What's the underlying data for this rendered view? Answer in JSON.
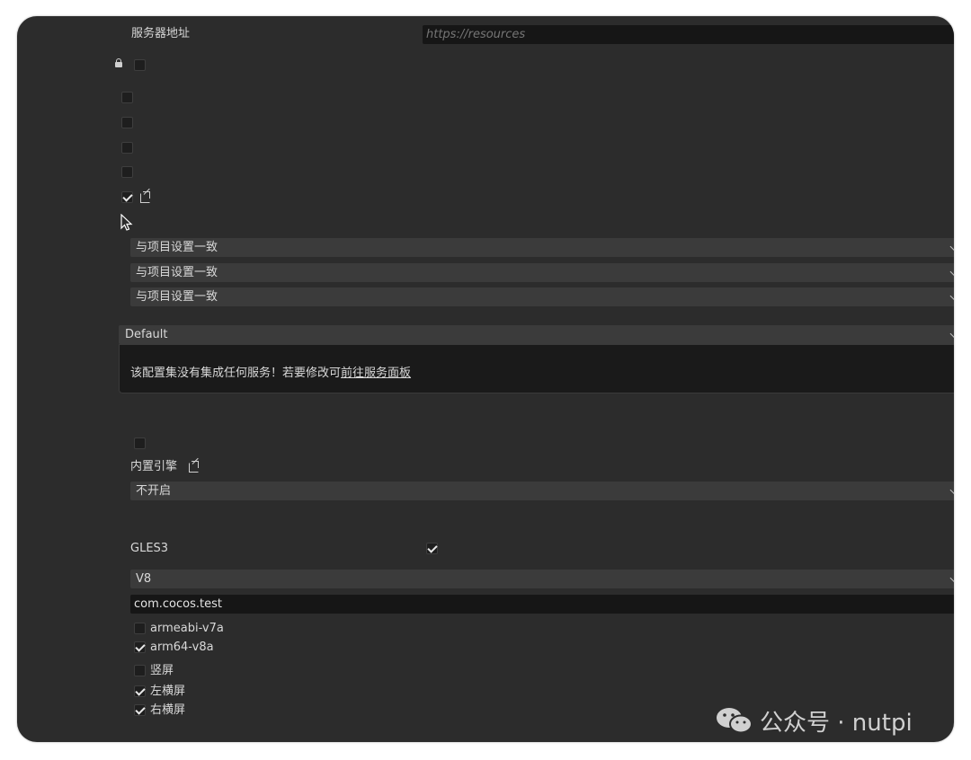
{
  "server": {
    "label": "服务器地址",
    "placeholder": "https://resources"
  },
  "selects": {
    "s1": "与项目设置一致",
    "s2": "与项目设置一致",
    "s3": "与项目设置一致",
    "config_set": "Default",
    "engine": "不开启",
    "js_engine": "V8"
  },
  "notice": {
    "text": "该配置集没有集成任何服务！若要修改可",
    "link": "前往服务面板"
  },
  "builtin_engine_label": "内置引擎",
  "gles3_label": "GLES3",
  "package_name": "com.cocos.test",
  "abis": {
    "armv7": "armeabi-v7a",
    "arm64": "arm64-v8a"
  },
  "orientation": {
    "portrait": "竖屏",
    "landscape_left": "左横屏",
    "landscape_right": "右横屏"
  },
  "watermark": "公众号 · nutpi"
}
